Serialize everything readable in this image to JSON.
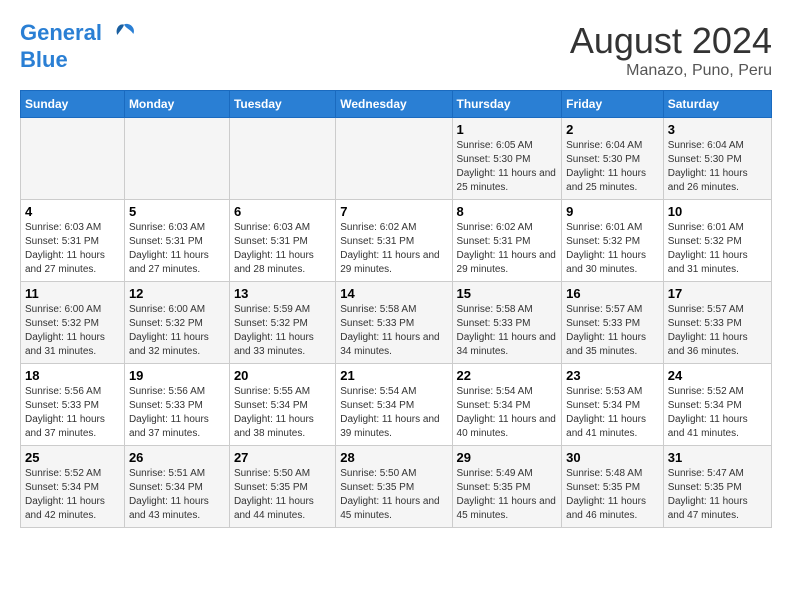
{
  "header": {
    "logo_line1": "General",
    "logo_line2": "Blue",
    "title": "August 2024",
    "subtitle": "Manazo, Puno, Peru"
  },
  "days_of_week": [
    "Sunday",
    "Monday",
    "Tuesday",
    "Wednesday",
    "Thursday",
    "Friday",
    "Saturday"
  ],
  "weeks": [
    [
      {
        "day": "",
        "sunrise": "",
        "sunset": "",
        "daylight": ""
      },
      {
        "day": "",
        "sunrise": "",
        "sunset": "",
        "daylight": ""
      },
      {
        "day": "",
        "sunrise": "",
        "sunset": "",
        "daylight": ""
      },
      {
        "day": "",
        "sunrise": "",
        "sunset": "",
        "daylight": ""
      },
      {
        "day": "1",
        "sunrise": "6:05 AM",
        "sunset": "5:30 PM",
        "daylight": "11 hours and 25 minutes."
      },
      {
        "day": "2",
        "sunrise": "6:04 AM",
        "sunset": "5:30 PM",
        "daylight": "11 hours and 25 minutes."
      },
      {
        "day": "3",
        "sunrise": "6:04 AM",
        "sunset": "5:30 PM",
        "daylight": "11 hours and 26 minutes."
      }
    ],
    [
      {
        "day": "4",
        "sunrise": "6:03 AM",
        "sunset": "5:31 PM",
        "daylight": "11 hours and 27 minutes."
      },
      {
        "day": "5",
        "sunrise": "6:03 AM",
        "sunset": "5:31 PM",
        "daylight": "11 hours and 27 minutes."
      },
      {
        "day": "6",
        "sunrise": "6:03 AM",
        "sunset": "5:31 PM",
        "daylight": "11 hours and 28 minutes."
      },
      {
        "day": "7",
        "sunrise": "6:02 AM",
        "sunset": "5:31 PM",
        "daylight": "11 hours and 29 minutes."
      },
      {
        "day": "8",
        "sunrise": "6:02 AM",
        "sunset": "5:31 PM",
        "daylight": "11 hours and 29 minutes."
      },
      {
        "day": "9",
        "sunrise": "6:01 AM",
        "sunset": "5:32 PM",
        "daylight": "11 hours and 30 minutes."
      },
      {
        "day": "10",
        "sunrise": "6:01 AM",
        "sunset": "5:32 PM",
        "daylight": "11 hours and 31 minutes."
      }
    ],
    [
      {
        "day": "11",
        "sunrise": "6:00 AM",
        "sunset": "5:32 PM",
        "daylight": "11 hours and 31 minutes."
      },
      {
        "day": "12",
        "sunrise": "6:00 AM",
        "sunset": "5:32 PM",
        "daylight": "11 hours and 32 minutes."
      },
      {
        "day": "13",
        "sunrise": "5:59 AM",
        "sunset": "5:32 PM",
        "daylight": "11 hours and 33 minutes."
      },
      {
        "day": "14",
        "sunrise": "5:58 AM",
        "sunset": "5:33 PM",
        "daylight": "11 hours and 34 minutes."
      },
      {
        "day": "15",
        "sunrise": "5:58 AM",
        "sunset": "5:33 PM",
        "daylight": "11 hours and 34 minutes."
      },
      {
        "day": "16",
        "sunrise": "5:57 AM",
        "sunset": "5:33 PM",
        "daylight": "11 hours and 35 minutes."
      },
      {
        "day": "17",
        "sunrise": "5:57 AM",
        "sunset": "5:33 PM",
        "daylight": "11 hours and 36 minutes."
      }
    ],
    [
      {
        "day": "18",
        "sunrise": "5:56 AM",
        "sunset": "5:33 PM",
        "daylight": "11 hours and 37 minutes."
      },
      {
        "day": "19",
        "sunrise": "5:56 AM",
        "sunset": "5:33 PM",
        "daylight": "11 hours and 37 minutes."
      },
      {
        "day": "20",
        "sunrise": "5:55 AM",
        "sunset": "5:34 PM",
        "daylight": "11 hours and 38 minutes."
      },
      {
        "day": "21",
        "sunrise": "5:54 AM",
        "sunset": "5:34 PM",
        "daylight": "11 hours and 39 minutes."
      },
      {
        "day": "22",
        "sunrise": "5:54 AM",
        "sunset": "5:34 PM",
        "daylight": "11 hours and 40 minutes."
      },
      {
        "day": "23",
        "sunrise": "5:53 AM",
        "sunset": "5:34 PM",
        "daylight": "11 hours and 41 minutes."
      },
      {
        "day": "24",
        "sunrise": "5:52 AM",
        "sunset": "5:34 PM",
        "daylight": "11 hours and 41 minutes."
      }
    ],
    [
      {
        "day": "25",
        "sunrise": "5:52 AM",
        "sunset": "5:34 PM",
        "daylight": "11 hours and 42 minutes."
      },
      {
        "day": "26",
        "sunrise": "5:51 AM",
        "sunset": "5:34 PM",
        "daylight": "11 hours and 43 minutes."
      },
      {
        "day": "27",
        "sunrise": "5:50 AM",
        "sunset": "5:35 PM",
        "daylight": "11 hours and 44 minutes."
      },
      {
        "day": "28",
        "sunrise": "5:50 AM",
        "sunset": "5:35 PM",
        "daylight": "11 hours and 45 minutes."
      },
      {
        "day": "29",
        "sunrise": "5:49 AM",
        "sunset": "5:35 PM",
        "daylight": "11 hours and 45 minutes."
      },
      {
        "day": "30",
        "sunrise": "5:48 AM",
        "sunset": "5:35 PM",
        "daylight": "11 hours and 46 minutes."
      },
      {
        "day": "31",
        "sunrise": "5:47 AM",
        "sunset": "5:35 PM",
        "daylight": "11 hours and 47 minutes."
      }
    ]
  ]
}
